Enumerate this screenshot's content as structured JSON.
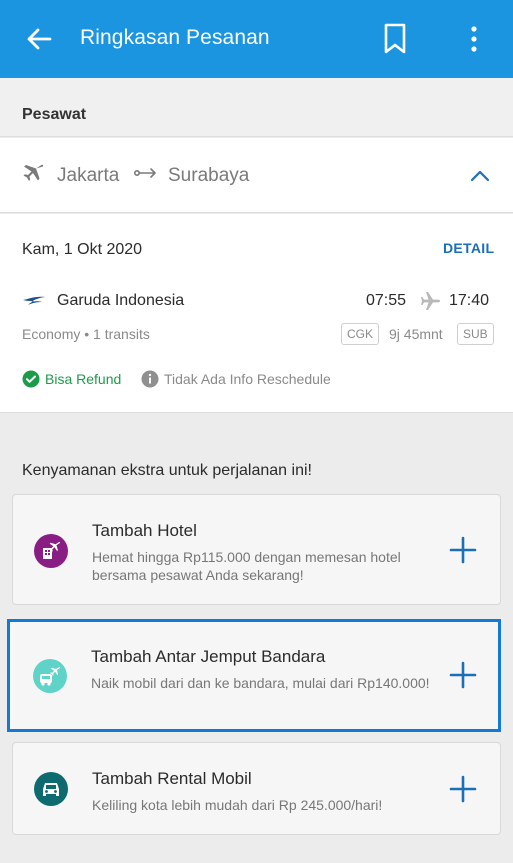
{
  "appbar": {
    "title": "Ringkasan Pesanan",
    "back_icon": "arrow-left-icon",
    "bookmark_icon": "bookmark-icon",
    "more_icon": "more-vertical-icon",
    "color": "#1b95e0"
  },
  "section": {
    "label": "Pesawat"
  },
  "route": {
    "from": "Jakarta",
    "to": "Surabaya",
    "collapse_icon": "chevron-up-icon"
  },
  "flight": {
    "date": "Kam, 1 Okt 2020",
    "detail_label": "DETAIL",
    "airline": "Garuda Indonesia",
    "departure_time": "07:55",
    "arrival_time": "17:40",
    "cabin": "Economy • 1 transits",
    "origin_code": "CGK",
    "duration": "9j 45mnt",
    "destination_code": "SUB",
    "refund": "Bisa Refund",
    "reschedule": "Tidak Ada Info Reschedule",
    "refund_color": "#1e9b4a"
  },
  "extras": {
    "title": "Kenyamanan ekstra untuk perjalanan ini!",
    "items": [
      {
        "title": "Tambah Hotel",
        "description": "Hemat hingga Rp115.000 dengan memesan hotel bersama pesawat Anda sekarang!",
        "icon": "hotel-plane-icon"
      },
      {
        "title": "Tambah Antar Jemput Bandara",
        "description": "Naik mobil dari dan ke bandara, mulai dari Rp140.000!",
        "icon": "airport-transfer-icon"
      },
      {
        "title": "Tambah Rental Mobil",
        "description": "Keliling kota lebih mudah dari Rp 245.000/hari!",
        "icon": "car-rental-icon"
      }
    ],
    "add_icon": "plus-icon",
    "accent": "#1a6fb5"
  }
}
